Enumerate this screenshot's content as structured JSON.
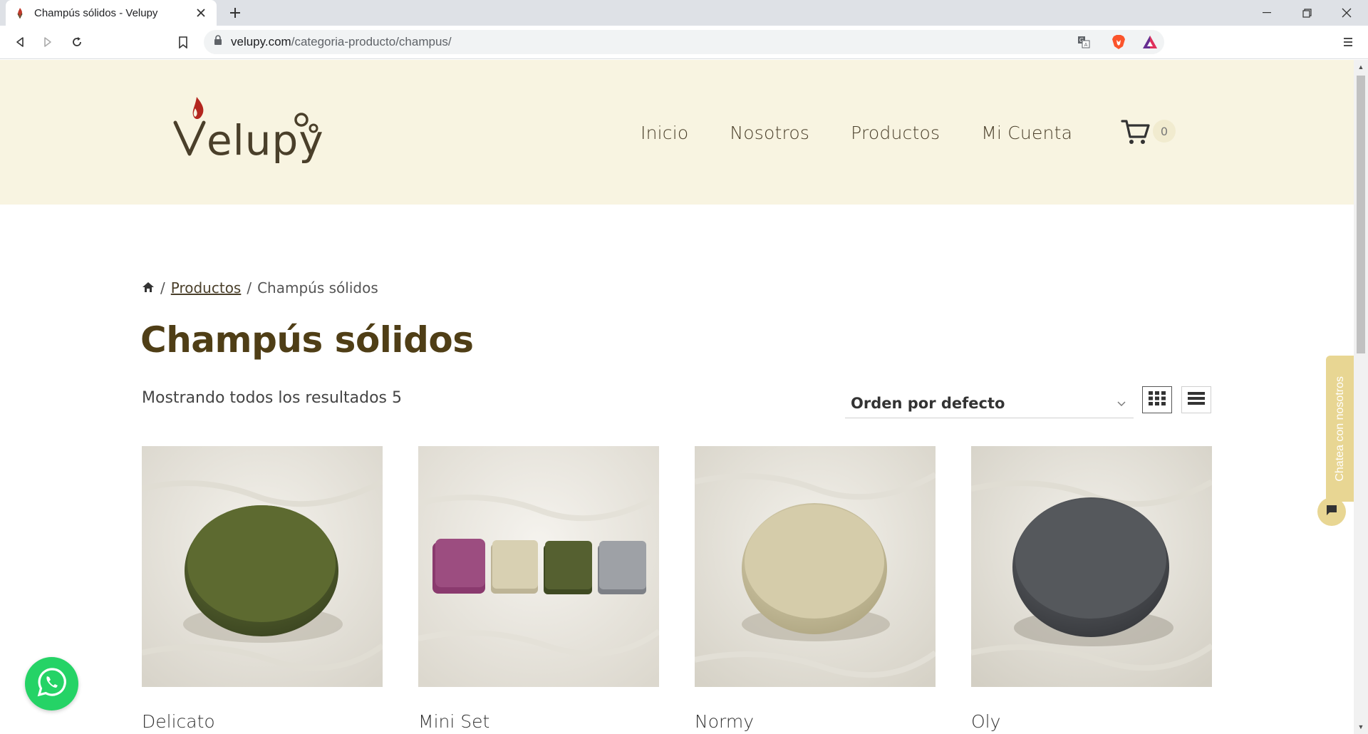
{
  "browser": {
    "tab_title": "Champús sólidos - Velupy",
    "url_host": "velupy.com",
    "url_path": "/categoria-producto/champus/"
  },
  "site": {
    "logo_text": "Velupy",
    "nav": [
      "Inicio",
      "Nosotros",
      "Productos",
      "Mi Cuenta"
    ],
    "cart_count": "0"
  },
  "breadcrumb": {
    "sep": "/",
    "link": "Productos",
    "current": "Champús sólidos"
  },
  "page_title": "Champús sólidos",
  "result_count": "Mostrando todos los resultados 5",
  "orderby": {
    "selected": "Orden por defecto"
  },
  "products": [
    {
      "name": "Delicato",
      "soap_color": "#5a6630"
    },
    {
      "name": "Mini Set",
      "soap_colors": [
        "#8a3a6e",
        "#d8d0b2",
        "#556030",
        "#9ea1a6"
      ]
    },
    {
      "name": "Normy",
      "soap_color": "#d5ccaa"
    },
    {
      "name": "Oly",
      "soap_color": "#55585c"
    }
  ],
  "chat": {
    "label": "Chatea con nosotros"
  },
  "colors": {
    "header_bg": "#f8f4e1",
    "title": "#4f3e16",
    "accent": "#e8d693",
    "whatsapp": "#25d366"
  }
}
